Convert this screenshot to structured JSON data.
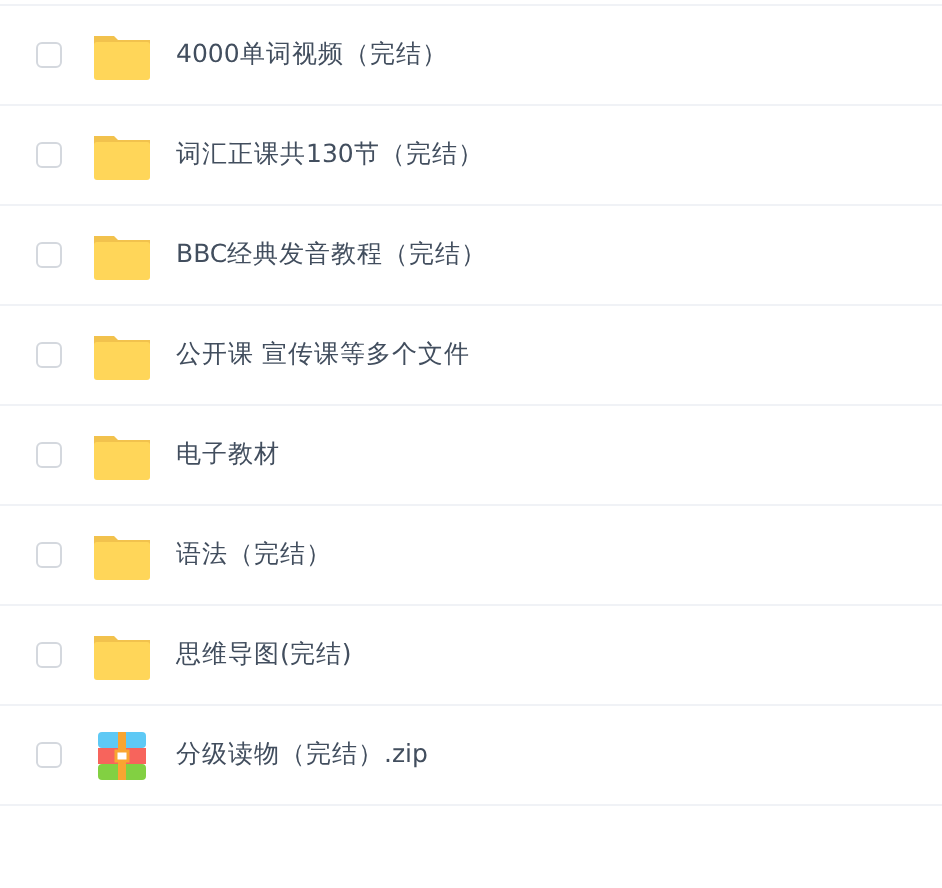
{
  "files": [
    {
      "name": "4000单词视频（完结）",
      "kind": "folder",
      "checked": false
    },
    {
      "name": "词汇正课共130节（完结）",
      "kind": "folder",
      "checked": false
    },
    {
      "name": "BBC经典发音教程（完结）",
      "kind": "folder",
      "checked": false
    },
    {
      "name": "公开课 宣传课等多个文件",
      "kind": "folder",
      "checked": false
    },
    {
      "name": "电子教材",
      "kind": "folder",
      "checked": false
    },
    {
      "name": "语法（完结）",
      "kind": "folder",
      "checked": false
    },
    {
      "name": "思维导图(完结)",
      "kind": "folder",
      "checked": false
    },
    {
      "name": "分级读物（完结）.zip",
      "kind": "zip",
      "checked": false
    }
  ]
}
